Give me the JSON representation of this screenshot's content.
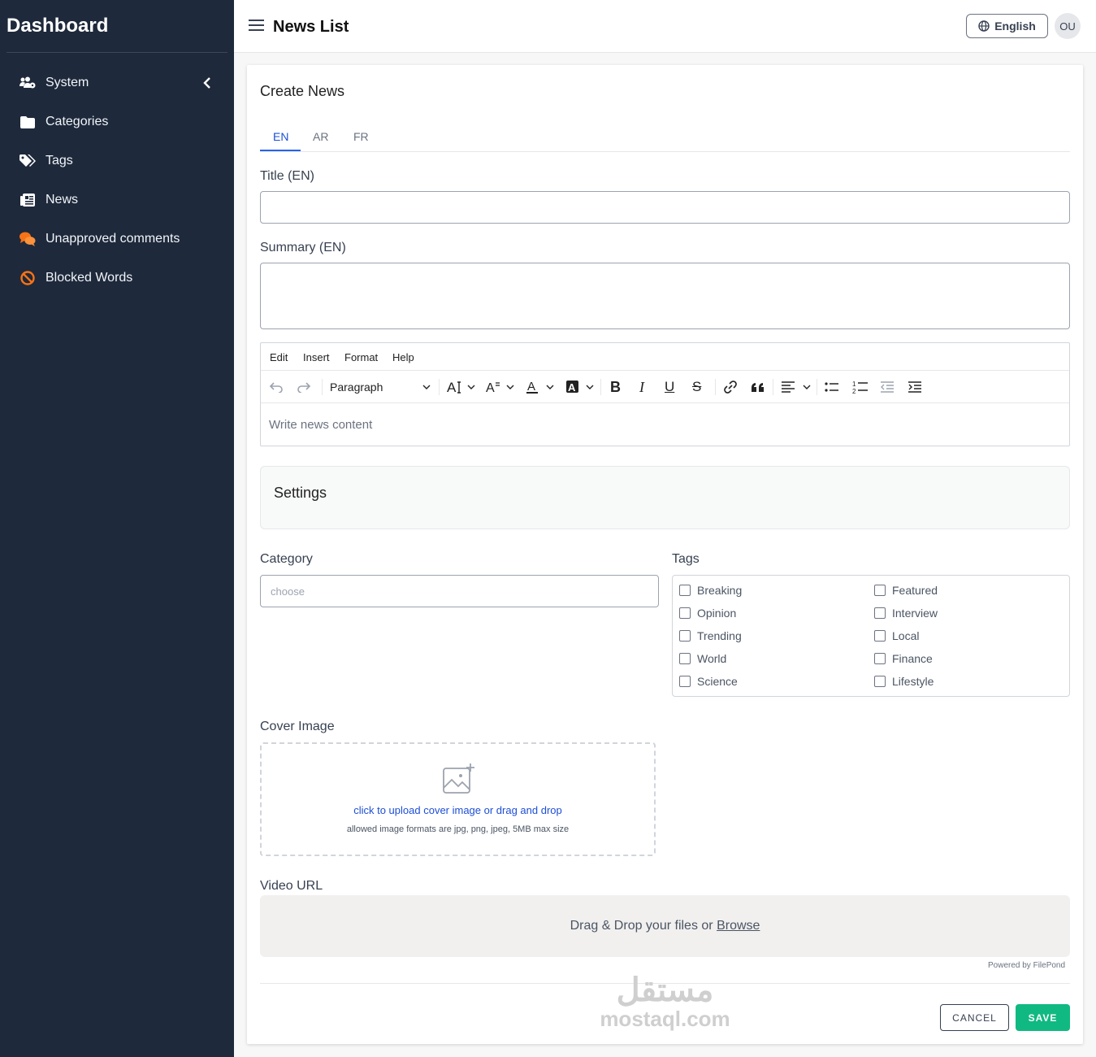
{
  "sidebar": {
    "brand": "Dashboard",
    "items": [
      {
        "label": "System",
        "icon": "users-gear-icon"
      },
      {
        "label": "Categories",
        "icon": "folder-icon"
      },
      {
        "label": "Tags",
        "icon": "tags-icon"
      },
      {
        "label": "News",
        "icon": "newspaper-icon"
      },
      {
        "label": "Unapproved comments",
        "icon": "comments-icon"
      },
      {
        "label": "Blocked Words",
        "icon": "ban-icon"
      }
    ]
  },
  "topbar": {
    "title": "News List",
    "language": "English",
    "avatar": "OU"
  },
  "form": {
    "heading": "Create News",
    "tabs": [
      "EN",
      "AR",
      "FR"
    ],
    "active_tab": "EN",
    "title_label": "Title (EN)",
    "title_value": "",
    "summary_label": "Summary (EN)",
    "summary_value": "",
    "editor": {
      "menu": [
        "Edit",
        "Insert",
        "Format",
        "Help"
      ],
      "block_format": "Paragraph",
      "placeholder": "Write news content"
    },
    "settings_title": "Settings",
    "category_label": "Category",
    "category_placeholder": "choose",
    "tags_label": "Tags",
    "tags": [
      "Breaking",
      "Featured",
      "Opinion",
      "Interview",
      "Trending",
      "Local",
      "World",
      "Finance",
      "Science",
      "Lifestyle"
    ],
    "cover_label": "Cover Image",
    "cover_cta": "click to upload cover image or drag and drop",
    "cover_hint": "allowed image formats are jpg, png, jpeg, 5MB max size",
    "video_label": "Video URL",
    "video_drop_text": "Drag & Drop your files or",
    "video_browse": "Browse",
    "powered_by": "Powered by FilePond",
    "cancel": "CANCEL",
    "save": "SAVE"
  },
  "watermark": {
    "arabic": "مستقل",
    "latin": "mostaql.com"
  },
  "colors": {
    "sidebar_bg": "#1e293b",
    "accent": "#2563eb",
    "save": "#10b981",
    "icon_orange": "#f97316"
  }
}
